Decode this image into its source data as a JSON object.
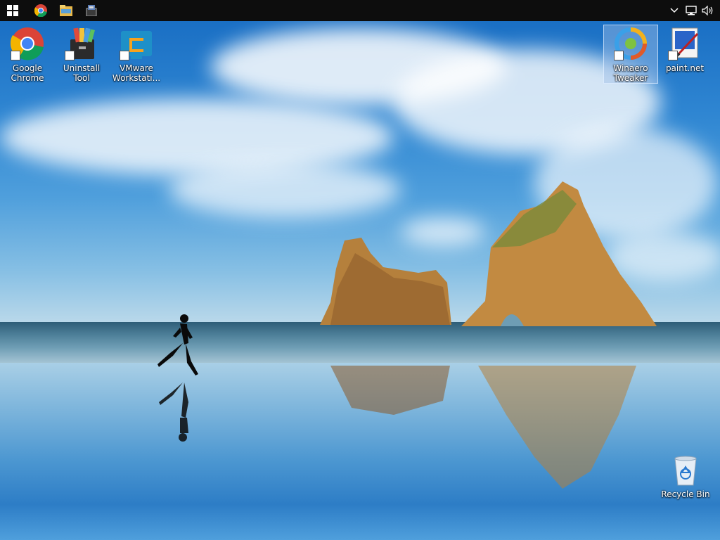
{
  "taskbar": {
    "start": {
      "icon": "windows-logo-icon"
    },
    "pinned": [
      {
        "name": "chrome-taskbar-icon"
      },
      {
        "name": "file-explorer-taskbar-icon"
      },
      {
        "name": "uninstall-tool-taskbar-icon"
      }
    ],
    "tray": [
      {
        "name": "show-hidden-icons-chevron-icon"
      },
      {
        "name": "network-icon"
      },
      {
        "name": "volume-icon"
      }
    ]
  },
  "desktop": {
    "icons": [
      {
        "label": "Google\nChrome",
        "icon": "chrome-icon"
      },
      {
        "label": "Uninstall Tool",
        "icon": "uninstall-tool-icon"
      },
      {
        "label": "VMware\nWorkstati...",
        "icon": "vmware-workstation-icon"
      },
      {
        "label": "Winaero\nTweaker",
        "icon": "winaero-tweaker-icon",
        "selected": true
      },
      {
        "label": "paint.net",
        "icon": "paint-net-icon"
      },
      {
        "label": "Recycle Bin",
        "icon": "recycle-bin-icon"
      }
    ]
  },
  "colors": {
    "taskbar": "#0d0d0d",
    "sky_top": "#1a6fc4",
    "label_text": "#ffffff",
    "selection": "#a0bee6"
  }
}
